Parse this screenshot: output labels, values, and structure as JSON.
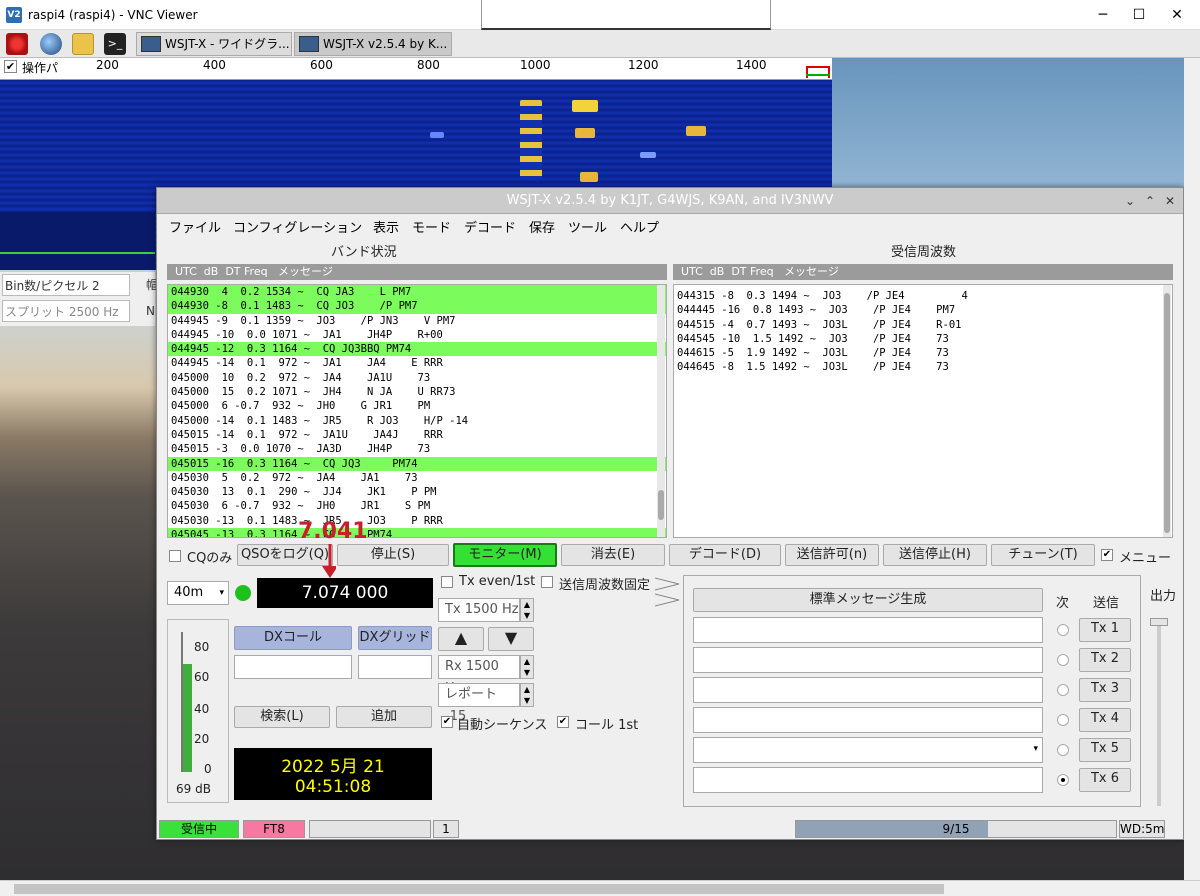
{
  "vnc": {
    "title": "raspi4 (raspi4) - VNC Viewer",
    "logo": "V2",
    "min": "─",
    "max": "☐",
    "close": "✕"
  },
  "taskbar": {
    "tasks": [
      "WSJT-X - ワイドグラ...",
      "WSJT-X   v2.5.4   by K..."
    ]
  },
  "waterfall": {
    "toolbar_label": "操作パ",
    "ticks": [
      "200",
      "400",
      "600",
      "800",
      "1000",
      "1200",
      "1400"
    ]
  },
  "left_controls": {
    "bins_label": "Bin数/ピクセル",
    "bins_value": "2",
    "split_label": "スプリット",
    "split_value": "2500 Hz",
    "side1": "帽",
    "side2": "N"
  },
  "wsjt": {
    "title": "WSJT-X   v2.5.4   by K1JT, G4WJS, K9AN, and IV3NWV",
    "window_controls": [
      "⌄",
      "⌃",
      "✕"
    ],
    "menu": [
      "ファイル",
      "コンフィグレーション",
      "表示",
      "モード",
      "デコード",
      "保存",
      "ツール",
      "ヘルプ"
    ],
    "band_title": "バンド状況",
    "rx_title": "受信周波数",
    "col_header": "UTC  dB  DT Freq   メッセージ",
    "band_lines": [
      {
        "t": "044930  4  0.2 1534 ~  CQ JA3    L PM7",
        "cq": true
      },
      {
        "t": "044930 -8  0.1 1483 ~  CQ JO3    /P PM7",
        "cq": true
      },
      {
        "t": "044945 -9  0.1 1359 ~  JO3    /P JN3    V PM7",
        "cq": false
      },
      {
        "t": "044945 -10  0.0 1071 ~  JA1    JH4P    R+00",
        "cq": false
      },
      {
        "t": "044945 -12  0.3 1164 ~  CQ JQ3BBQ PM74",
        "cq": true
      },
      {
        "t": "044945 -14  0.1  972 ~  JA1    JA4    E RRR",
        "cq": false
      },
      {
        "t": "045000  10  0.2  972 ~  JA4    JA1U    73",
        "cq": false
      },
      {
        "t": "045000  15  0.2 1071 ~  JH4    N JA    U RR73",
        "cq": false
      },
      {
        "t": "045000  6 -0.7  932 ~  JH0    G JR1    PM",
        "cq": false
      },
      {
        "t": "045000 -14  0.1 1483 ~  JR5    R JO3    H/P -14",
        "cq": false
      },
      {
        "t": "045015 -14  0.1  972 ~  JA1U    JA4J    RRR",
        "cq": false
      },
      {
        "t": "045015 -3  0.0 1070 ~  JA3D    JH4P    73",
        "cq": false
      },
      {
        "t": "045015 -16  0.3 1164 ~  CQ JQ3     PM74",
        "cq": true
      },
      {
        "t": "045030  5  0.2  972 ~  JA4    JA1    73",
        "cq": false
      },
      {
        "t": "045030  13  0.1  290 ~  JJ4    JK1    P PM",
        "cq": false
      },
      {
        "t": "045030  6 -0.7  932 ~  JH0    JR1    S PM",
        "cq": false
      },
      {
        "t": "045030 -13  0.1 1483 ~  JR5    JO3    P RRR",
        "cq": false
      },
      {
        "t": "045045 -13  0.3 1164 ~  CQ     PM74",
        "cq": true
      }
    ],
    "rx_lines": [
      "044315 -8  0.3 1494 ~  JO3    /P JE4         4",
      "044445 -16  0.8 1493 ~  JO3    /P JE4    PM7",
      "044515 -4  0.7 1493 ~  JO3L    /P JE4    R-01",
      "044545 -10  1.5 1492 ~  JO3    /P JE4    73",
      "044615 -5  1.9 1492 ~  JO3L    /P JE4    73",
      "044645 -8  1.5 1492 ~  JO3L    /P JE4    73"
    ],
    "buttons": {
      "cq_only": "CQのみ",
      "log_qso": "QSOをログ(Q)",
      "stop": "停止(S)",
      "monitor": "モニター(M)",
      "erase": "消去(E)",
      "decode": "デコード(D)",
      "enable_tx": "送信許可(n)",
      "halt_tx": "送信停止(H)",
      "tune": "チューン(T)",
      "menus": "メニュー"
    },
    "band": "40m",
    "dial_freq": "7.074 000",
    "overlay_freq": "7.041",
    "tx_even": "Tx even/1st",
    "tx_freq_lock": "送信周波数固定",
    "tx_hz": "Tx  1500  Hz",
    "rx_hz": "Rx  1500  Hz",
    "report": "レポート -15",
    "auto_seq": "自動シーケンス",
    "call_first": "コール 1st",
    "dx_call": "DXコール",
    "dx_grid": "DXグリッド",
    "up": "▲",
    "down": "▼",
    "search": "検索(L)",
    "add": "追加",
    "date": "2022 5月 21",
    "time": "04:51:08",
    "meter_db": "69 dB",
    "meter_ticks": [
      "80",
      "60",
      "40",
      "20",
      "0"
    ],
    "gen_std": "標準メッセージ生成",
    "next_label": "次",
    "send_label": "送信",
    "tx_buttons": [
      "Tx 1",
      "Tx 2",
      "Tx 3",
      "Tx 4",
      "Tx 5",
      "Tx 6"
    ],
    "power_label": "出力",
    "status": {
      "rx": "受信中",
      "mode": "FT8",
      "num": "1",
      "progress": "9/15",
      "wd": "WD:5m"
    },
    "progress_frac": 0.6,
    "colors": {
      "cq_green": "#7cfc5c",
      "monitor_green": "#34e034",
      "status_rx": "#3ce03c",
      "status_mode": "#f778a1"
    }
  }
}
